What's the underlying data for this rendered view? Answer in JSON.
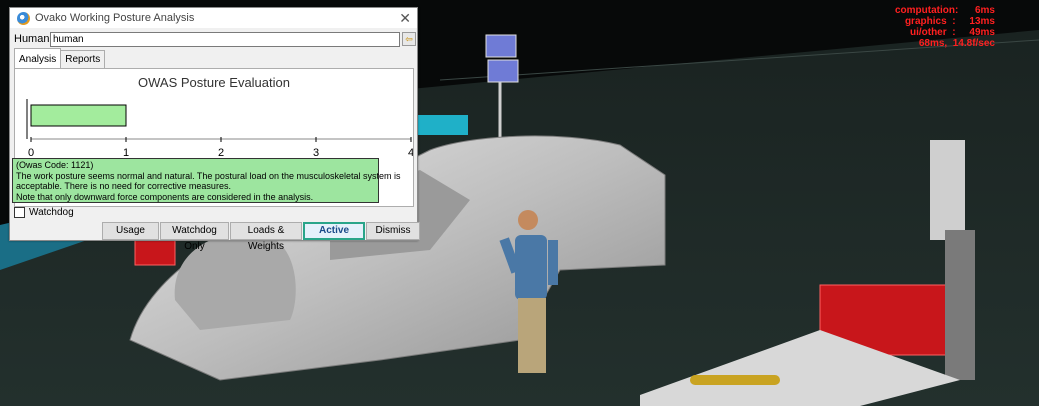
{
  "stats": {
    "lines": [
      "computation:      6ms",
      "graphics  :     13ms",
      "ui/other  :     49ms",
      "68ms,  14.8f/sec"
    ]
  },
  "dialog": {
    "title": "Ovako Working Posture Analysis",
    "human_label": "Human:",
    "human_value": "human",
    "tabs": [
      {
        "label": "Analysis"
      },
      {
        "label": "Reports"
      }
    ],
    "chart_title": "OWAS Posture Evaluation",
    "result_lines": [
      "(Owas Code: 1121)",
      "The work posture seems normal and natural. The postural load on the musculoskeletal system is",
      "acceptable. There is no need for corrective measures.",
      " Note that only downward force components are considered in the analysis."
    ],
    "watchdog_label": "Watchdog",
    "buttons": [
      {
        "label": "Usage"
      },
      {
        "label": "Watchdog Only"
      },
      {
        "label": "Loads & Weights"
      },
      {
        "label": "Active"
      },
      {
        "label": "Dismiss"
      }
    ]
  },
  "chart_data": {
    "type": "bar",
    "orientation": "horizontal",
    "title": "OWAS Posture Evaluation",
    "categories": [
      ""
    ],
    "values": [
      1
    ],
    "xlim": [
      0,
      4
    ],
    "xticks": [
      "0",
      "1",
      "2",
      "3",
      "4"
    ],
    "bar_color": "#a3ec9d",
    "grid": false
  },
  "colors": {
    "accent": "#29a58a",
    "result_bg": "#9de59f",
    "stats_text": "#ff2020"
  }
}
